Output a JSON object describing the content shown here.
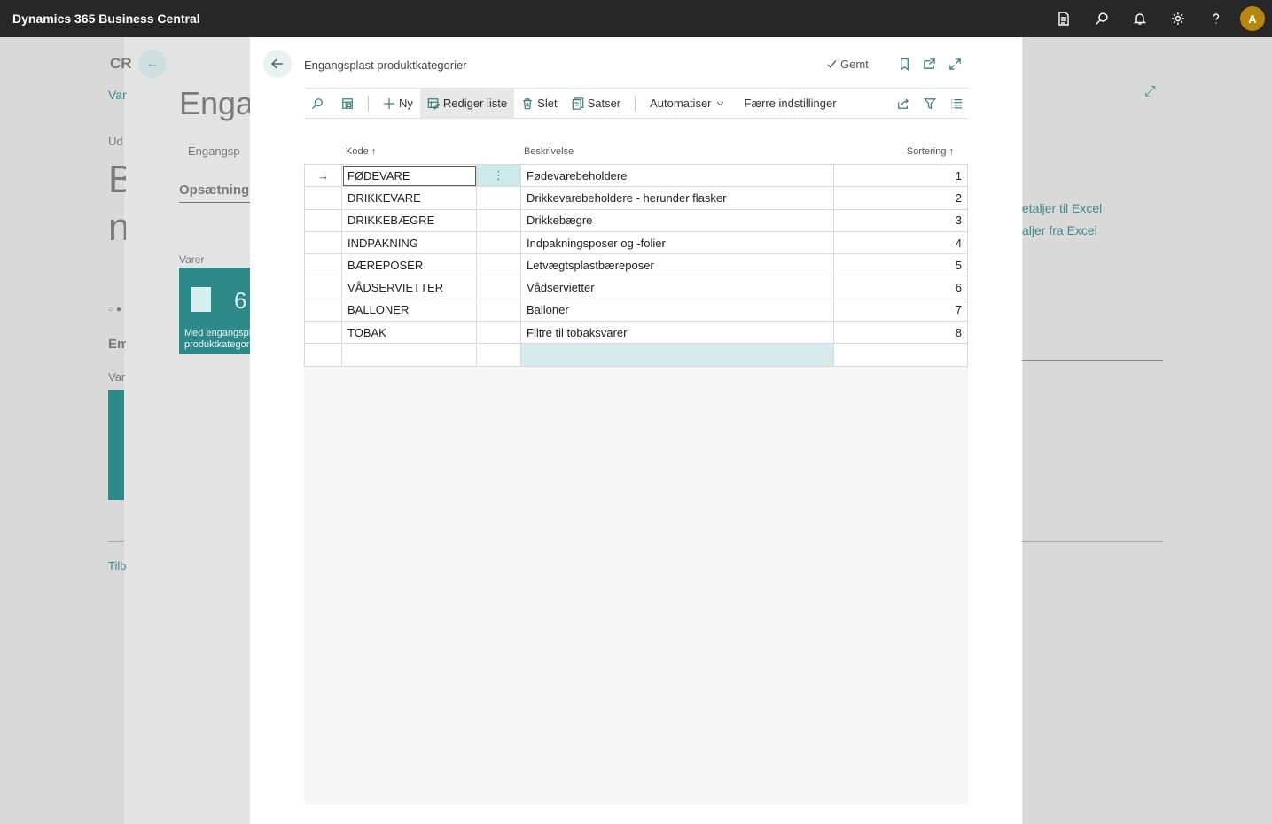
{
  "app": {
    "title": "Dynamics 365 Business Central",
    "avatar_initial": "A",
    "icons": [
      "document-icon",
      "search-icon",
      "bell-icon",
      "gear-icon",
      "help-icon"
    ]
  },
  "background": {
    "crumb": "CR",
    "var1": "Var",
    "ud": "Ud",
    "heading": "Engar",
    "tab1": "Engangsp",
    "setup": "Opsætning",
    "big_b": "B",
    "big_n": "n",
    "varer": "Varer",
    "tile_count": "6",
    "tile_caption_1": "Med engangspl",
    "tile_caption_2": "produktkategori",
    "em": "Em",
    "var2": "Var",
    "tilb": "Tilb",
    "excel_export": "etaljer til Excel",
    "excel_import": "aljer fra Excel"
  },
  "dialog": {
    "title": "Engangsplast produktkategorier",
    "saved_label": "Gemt",
    "actions": {
      "new": "Ny",
      "edit_list": "Rediger liste",
      "delete": "Slet",
      "rates": "Satser",
      "automate": "Automatiser",
      "fewer_options": "Færre indstillinger"
    },
    "columns": {
      "code": "Kode",
      "description": "Beskrivelse",
      "sorting": "Sortering"
    },
    "rows": [
      {
        "code": "FØDEVARE",
        "description": "Fødevarebeholdere",
        "sort": "1"
      },
      {
        "code": "DRIKKEVARE",
        "description": "Drikkevarebeholdere - herunder flasker",
        "sort": "2"
      },
      {
        "code": "DRIKKEBÆGRE",
        "description": "Drikkebægre",
        "sort": "3"
      },
      {
        "code": "INDPAKNING",
        "description": "Indpakningsposer og -folier",
        "sort": "4"
      },
      {
        "code": "BÆREPOSER",
        "description": "Letvægtsplastbæreposer",
        "sort": "5"
      },
      {
        "code": "VÅDSERVIETTER",
        "description": "Vådservietter",
        "sort": "6"
      },
      {
        "code": "BALLONER",
        "description": "Balloner",
        "sort": "7"
      },
      {
        "code": "TOBAK",
        "description": "Filtre til tobaksvarer",
        "sort": "8"
      }
    ]
  },
  "colors": {
    "topbar": "#272727",
    "accent": "#3a7d7c",
    "selected_cell": "#cde9ea",
    "avatar": "#b8860b"
  }
}
